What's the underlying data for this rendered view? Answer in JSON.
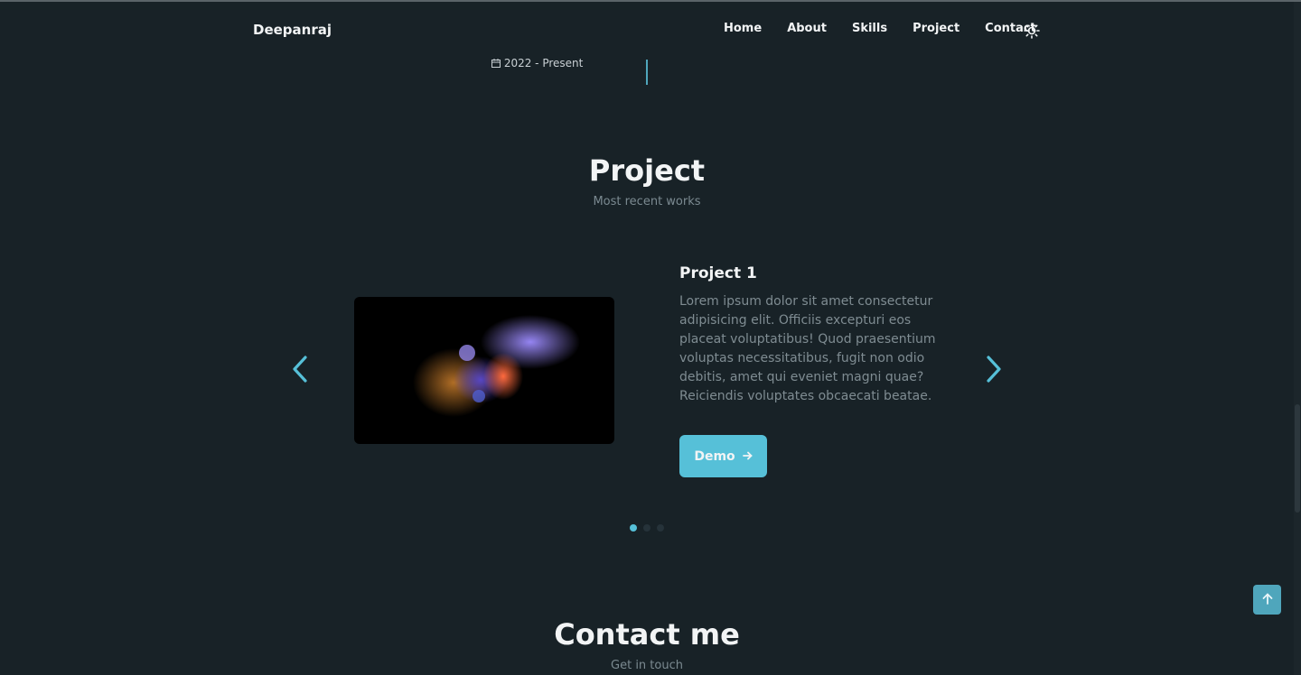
{
  "header": {
    "logo": "Deepanraj",
    "nav": [
      "Home",
      "About",
      "Skills",
      "Project",
      "Contact"
    ],
    "theme_icon": "sun-icon"
  },
  "qualification": {
    "date": "2022 - Present",
    "date_icon": "calendar-icon"
  },
  "project_section": {
    "title": "Project",
    "subtitle": "Most recent works",
    "item": {
      "title": "Project 1",
      "description": "Lorem ipsum dolor sit amet consectetur adipisicing elit. Officiis excepturi eos placeat voluptatibus! Quod praesentium voluptas necessitatibus, fugit non odio debitis, amet qui eveniet magni quae? Reiciendis voluptates obcaecati beatae.",
      "button_label": "Demo",
      "button_icon": "arrow-right-icon"
    },
    "prev_icon": "chevron-left-icon",
    "next_icon": "chevron-right-icon",
    "slides": {
      "count": 3,
      "active_index": 0
    }
  },
  "contact_section": {
    "title": "Contact me",
    "subtitle": "Get in touch"
  },
  "colors": {
    "background": "#182227",
    "accent": "#56c0d8",
    "text": "#f2f4f5",
    "muted": "#7f8c92"
  }
}
